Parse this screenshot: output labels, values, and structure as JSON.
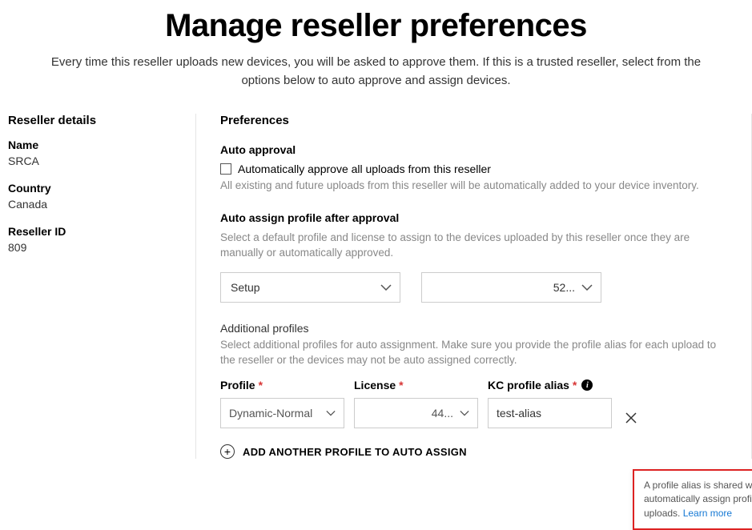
{
  "header": {
    "title": "Manage reseller preferences",
    "subtitle": "Every time this reseller uploads new devices, you will be asked to approve them. If this is a trusted reseller, select from the options below to auto approve and assign devices."
  },
  "sidebar": {
    "heading": "Reseller details",
    "details": [
      {
        "label": "Name",
        "value": "SRCA"
      },
      {
        "label": "Country",
        "value": "Canada"
      },
      {
        "label": "Reseller ID",
        "value": "809"
      }
    ]
  },
  "content": {
    "heading": "Preferences",
    "autoApproval": {
      "heading": "Auto approval",
      "checkboxLabel": "Automatically approve all uploads from this reseller",
      "help": "All existing and future uploads from this reseller will be automatically added to your device inventory."
    },
    "autoAssign": {
      "heading": "Auto assign profile after approval",
      "help": "Select a default profile and license to assign to the devices uploaded by this reseller once they are manually or automatically approved.",
      "profileSelect": "Setup",
      "licenseSelect": "52..."
    },
    "additional": {
      "heading": "Additional profiles",
      "help": "Select additional profiles for auto assignment. Make sure you provide the profile alias for each upload to the reseller or the devices may not be auto assigned correctly.",
      "fields": {
        "profileLabel": "Profile",
        "licenseLabel": "License",
        "aliasLabel": "KC profile alias",
        "profileValue": "Dynamic-Normal",
        "licenseValue": "44...",
        "aliasValue": "test-alias"
      },
      "addButton": "ADD ANOTHER PROFILE TO AUTO ASSIGN"
    },
    "tooltip": {
      "text": "A profile alias is shared with the reseller to automatically assign profiles to approved uploads. ",
      "link": "Learn more"
    }
  }
}
